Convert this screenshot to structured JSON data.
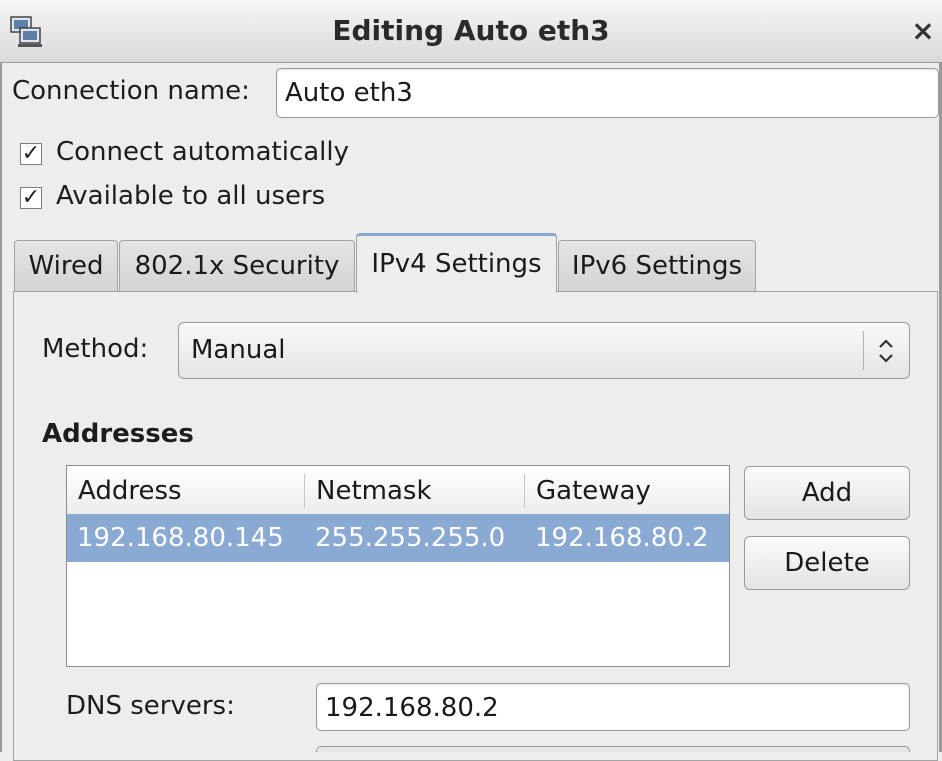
{
  "window": {
    "title": "Editing Auto eth3",
    "close_glyph": "×",
    "icon": "network-computer-icon"
  },
  "connection": {
    "name_label": "Connection name:",
    "name_value": "Auto eth3"
  },
  "options": {
    "connect_auto_label": "Connect automatically",
    "connect_auto_checked": true,
    "all_users_label": "Available to all users",
    "all_users_checked": true,
    "check_glyph": "✓"
  },
  "tabs": [
    {
      "label": "Wired",
      "active": false
    },
    {
      "label": "802.1x Security",
      "active": false
    },
    {
      "label": "IPv4 Settings",
      "active": true
    },
    {
      "label": "IPv6 Settings",
      "active": false
    }
  ],
  "ipv4": {
    "method_label": "Method:",
    "method_value": "Manual",
    "addresses_heading": "Addresses",
    "columns": [
      "Address",
      "Netmask",
      "Gateway"
    ],
    "rows": [
      {
        "address": "192.168.80.145",
        "netmask": "255.255.255.0",
        "gateway": "192.168.80.2",
        "selected": true
      }
    ],
    "add_label": "Add",
    "delete_label": "Delete",
    "dns_label": "DNS servers:",
    "dns_value": "192.168.80.2"
  },
  "colors": {
    "selection": "#8aa9d3",
    "active_tab_accent": "#87a9d0"
  }
}
